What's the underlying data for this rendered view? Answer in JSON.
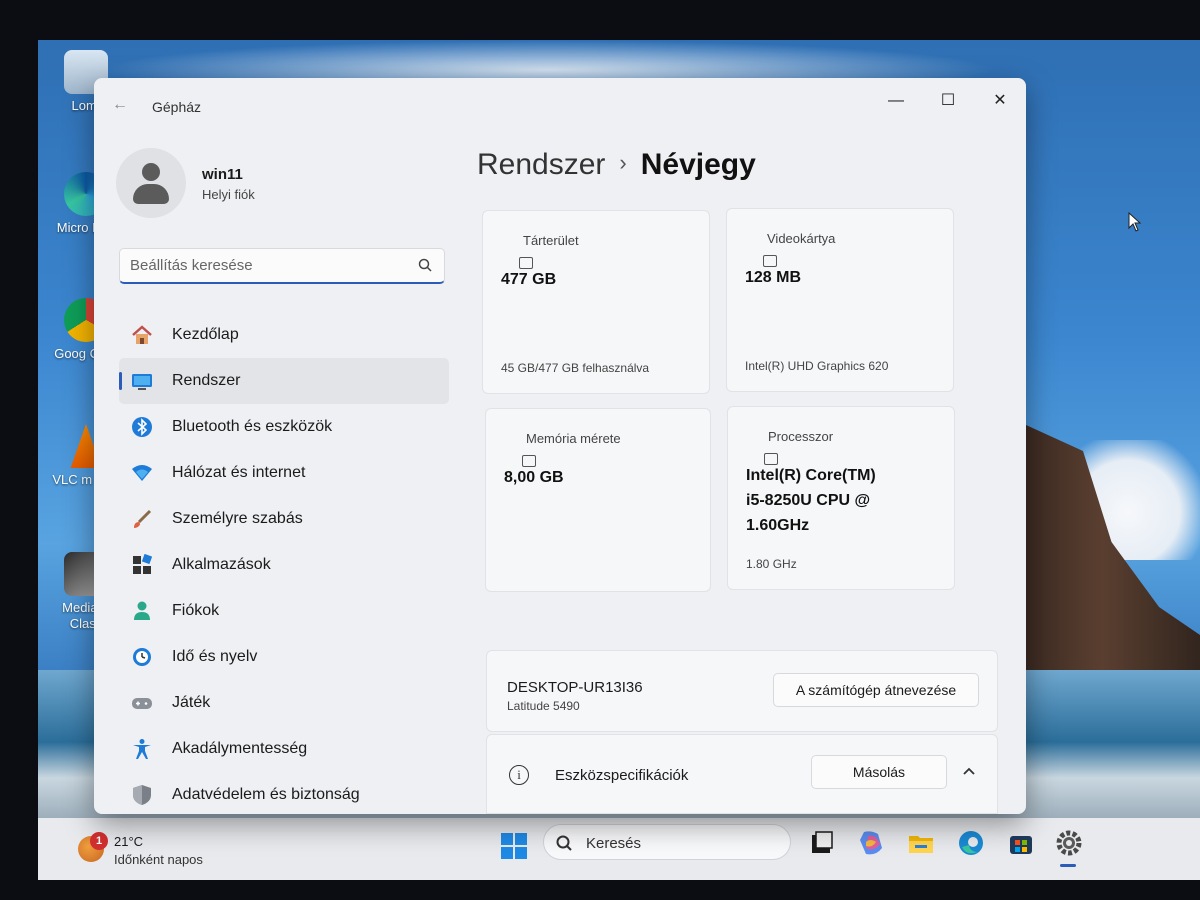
{
  "desktop": {
    "icons": [
      {
        "label": "Lomt",
        "icon": "recycle-bin-icon"
      },
      {
        "label": "Micro Edg",
        "icon": "edge-icon"
      },
      {
        "label": "Goog Chro",
        "icon": "chrome-icon"
      },
      {
        "label": "VLC m play",
        "icon": "vlc-icon"
      },
      {
        "label": "Media P Class",
        "icon": "media-player-classic-icon"
      }
    ]
  },
  "window": {
    "title": "Gépház",
    "back_icon": "back-arrow-icon",
    "controls": {
      "minimize": "—",
      "maximize": "☐",
      "close": "✕"
    }
  },
  "user": {
    "name": "win11",
    "account": "Helyi fiók"
  },
  "search": {
    "placeholder": "Beállítás keresése"
  },
  "nav": {
    "items": [
      {
        "label": "Kezdőlap",
        "icon": "home-icon",
        "active": false
      },
      {
        "label": "Rendszer",
        "icon": "monitor-icon",
        "active": true
      },
      {
        "label": "Bluetooth és eszközök",
        "icon": "bluetooth-icon",
        "active": false
      },
      {
        "label": "Hálózat és internet",
        "icon": "wifi-icon",
        "active": false
      },
      {
        "label": "Személyre szabás",
        "icon": "brush-icon",
        "active": false
      },
      {
        "label": "Alkalmazások",
        "icon": "apps-icon",
        "active": false
      },
      {
        "label": "Fiókok",
        "icon": "person-icon",
        "active": false
      },
      {
        "label": "Idő és nyelv",
        "icon": "clock-globe-icon",
        "active": false
      },
      {
        "label": "Játék",
        "icon": "gamepad-icon",
        "active": false
      },
      {
        "label": "Akadálymentesség",
        "icon": "accessibility-icon",
        "active": false
      },
      {
        "label": "Adatvédelem és biztonság",
        "icon": "shield-icon",
        "active": false
      }
    ]
  },
  "breadcrumb": {
    "parent": "Rendszer",
    "separator": "›",
    "current": "Névjegy"
  },
  "cards": {
    "storage": {
      "title": "Tárterület",
      "value": "477 GB",
      "footer": "45 GB/477 GB felhasználva"
    },
    "gpu": {
      "title": "Videokártya",
      "value": "128 MB",
      "footer": "Intel(R) UHD Graphics 620"
    },
    "memory": {
      "title": "Memória mérete",
      "value": "8,00 GB",
      "footer": ""
    },
    "cpu": {
      "title": "Processzor",
      "value_lines": [
        "Intel(R) Core(TM)",
        "i5-8250U CPU @",
        "1.60GHz"
      ],
      "footer": "1.80 GHz"
    }
  },
  "device": {
    "name": "DESKTOP-UR13I36",
    "model": "Latitude 5490",
    "rename_label": "A számítógép átnevezése"
  },
  "specs": {
    "title": "Eszközspecifikációk",
    "copy_label": "Másolás"
  },
  "taskbar": {
    "weather_badge": "1",
    "temperature": "21°C",
    "weather": "Időnként napos",
    "search_label": "Keresés",
    "apps": [
      "task-view-icon",
      "copilot-icon",
      "file-explorer-icon",
      "edge-icon",
      "store-icon",
      "settings-icon"
    ]
  },
  "colors": {
    "accent": "#2b5cb8",
    "window_bg": "#eef0f3",
    "card_bg": "#f6f7f9"
  }
}
